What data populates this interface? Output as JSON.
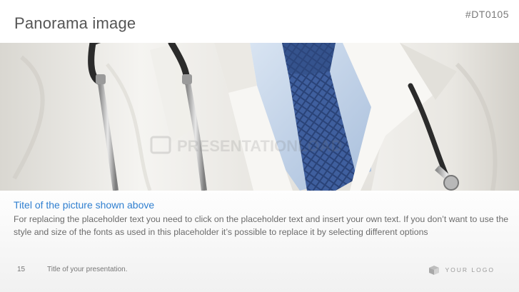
{
  "slide": {
    "title": "Panorama image",
    "code": "#DT0105"
  },
  "image": {
    "icon": "doctor-coat-stethoscope-photo",
    "watermark": "PRESENTATIONLOAD"
  },
  "caption": {
    "title": "Titel of the picture shown above",
    "body": "For replacing the placeholder text you need to click on the placeholder text and insert your own text. If you don’t want to use the style and size of the fonts as used in this placeholder it’s possible to replace it by selecting different options"
  },
  "footer": {
    "page_number": "15",
    "presentation_title": "Title of your presentation.",
    "logo_text": "YOUR LOGO"
  },
  "colors": {
    "accent": "#2f7fd0",
    "tie": "#3a5a9a",
    "shirt": "#c9d9ee"
  }
}
